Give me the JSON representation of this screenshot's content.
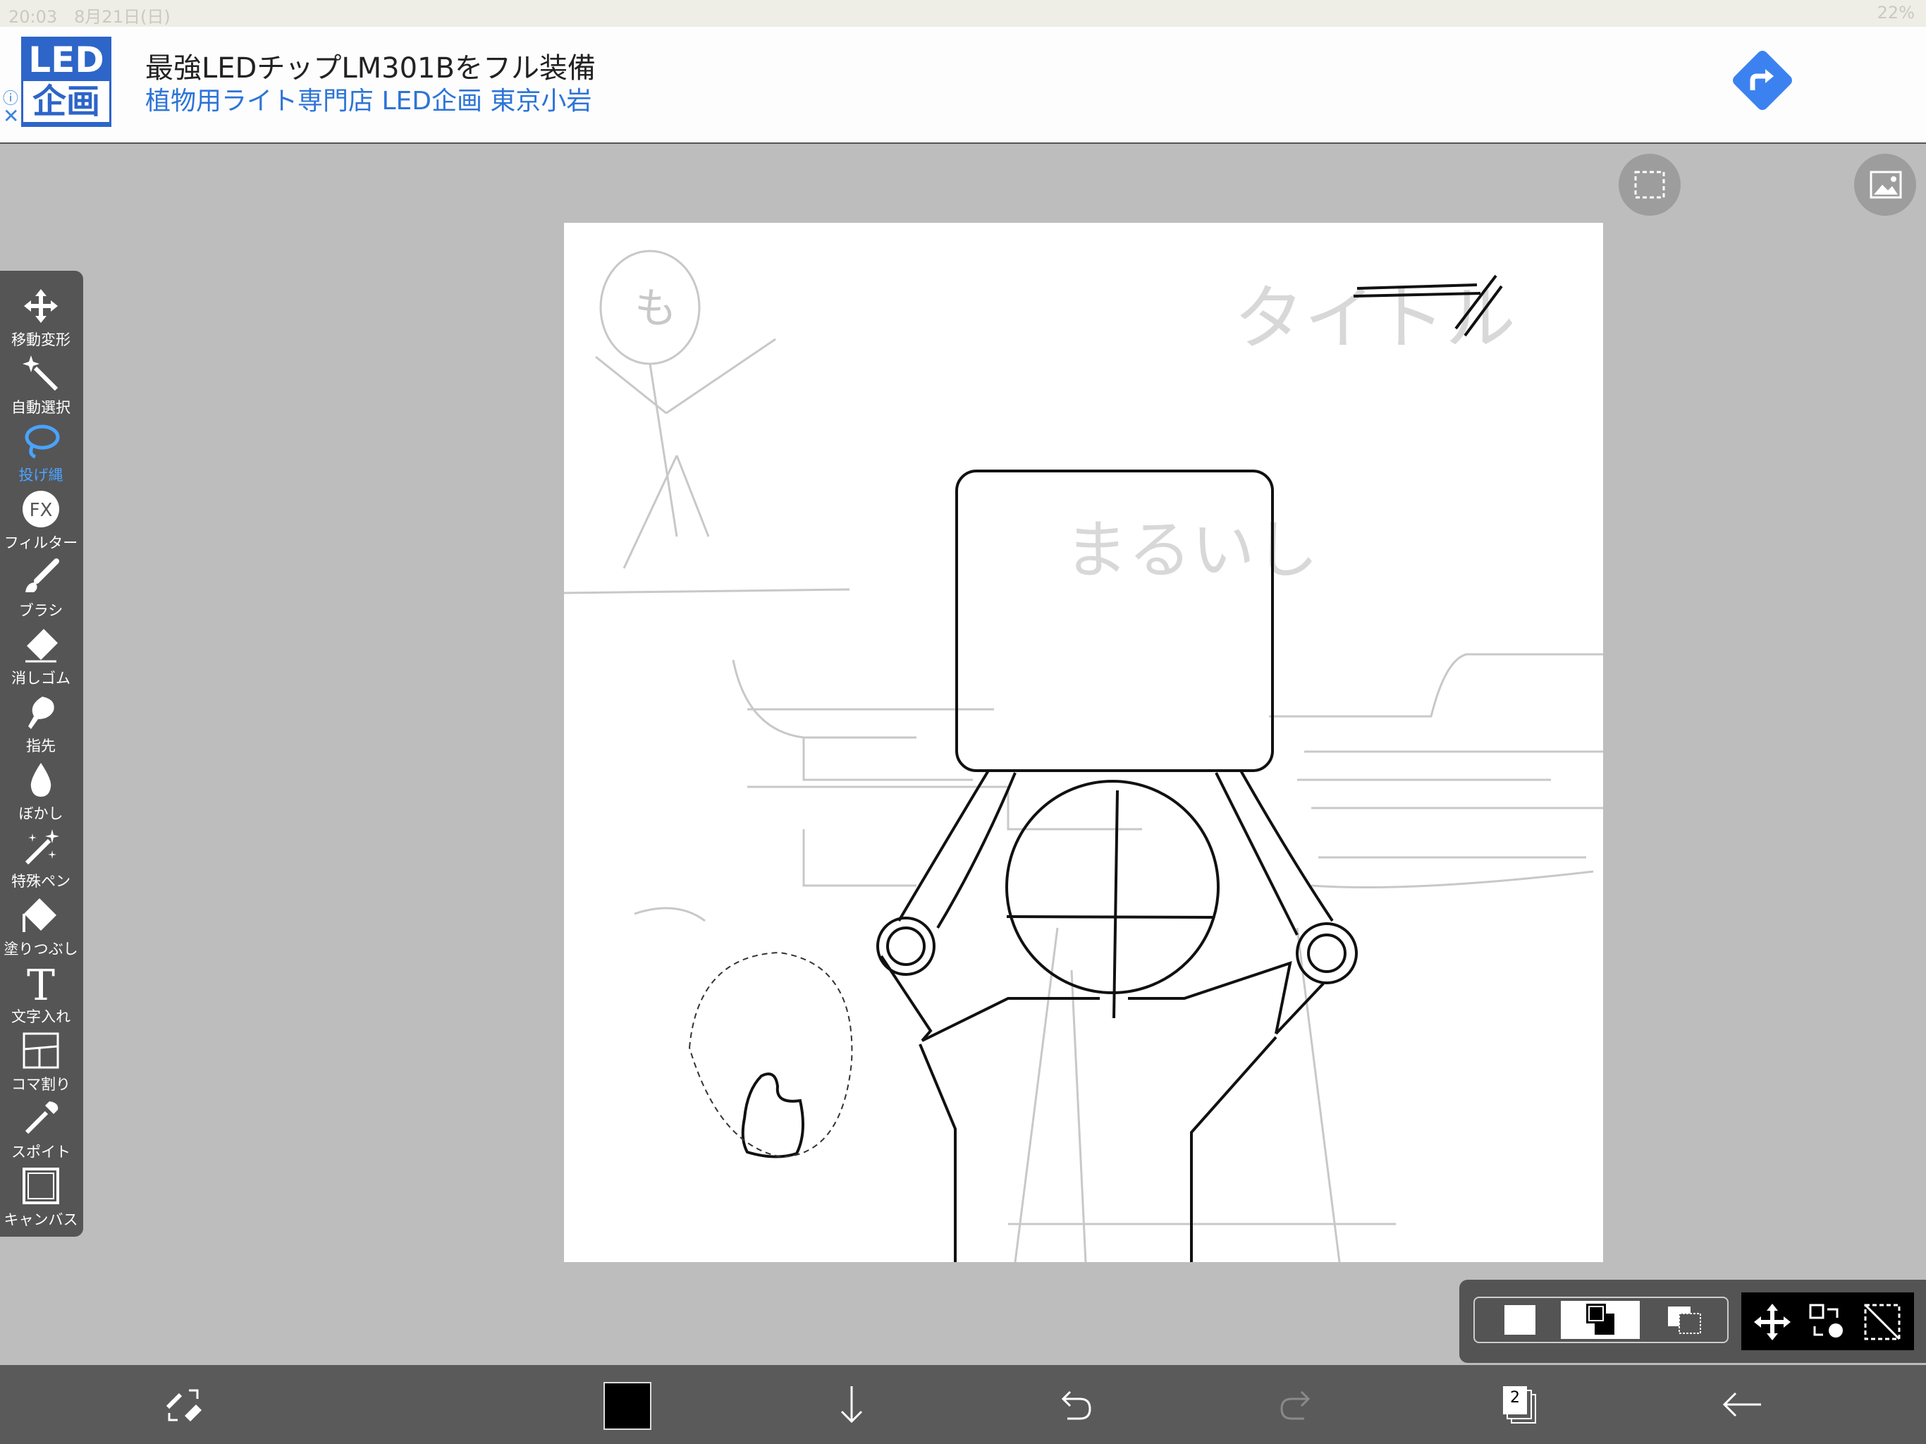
{
  "status_bar": {
    "time_date": "20:03　8月21日(日)",
    "battery": "22%"
  },
  "ad": {
    "logo_line1": "LED",
    "logo_line2": "企画",
    "title": "最強LEDチップLM301Bをフル装備",
    "subtitle": "植物用ライト専門店 LED企画 東京小岩",
    "info_icon": "info-icon",
    "close_label": "✕"
  },
  "top_buttons": [
    {
      "icon": "selection-icon"
    },
    {
      "icon": "image-icon"
    }
  ],
  "toolbar": {
    "active_tool": "投げ縄",
    "active_color": "#4aa3ff",
    "tools": [
      {
        "label": "移動変形",
        "icon": "move-transform-icon"
      },
      {
        "label": "自動選択",
        "icon": "magic-wand-icon"
      },
      {
        "label": "投げ縄",
        "icon": "lasso-icon"
      },
      {
        "label": "フィルター",
        "icon": "fx-filter-icon"
      },
      {
        "label": "ブラシ",
        "icon": "brush-icon"
      },
      {
        "label": "消しゴム",
        "icon": "eraser-icon"
      },
      {
        "label": "指先",
        "icon": "finger-smudge-icon"
      },
      {
        "label": "ぼかし",
        "icon": "blur-drop-icon"
      },
      {
        "label": "特殊ペン",
        "icon": "special-pen-icon"
      },
      {
        "label": "塗りつぶし",
        "icon": "bucket-fill-icon"
      },
      {
        "label": "文字入れ",
        "icon": "text-icon"
      },
      {
        "label": "コマ割り",
        "icon": "panel-layout-icon"
      },
      {
        "label": "スポイト",
        "icon": "eyedropper-icon"
      },
      {
        "label": "キャンバス",
        "icon": "canvas-icon"
      }
    ]
  },
  "canvas": {
    "background": "#ffffff",
    "sketch_text_1": "タイトル",
    "sketch_text_2": "まるいし",
    "sketch_text_3": "も"
  },
  "selection_bar": {
    "modes": [
      "new-selection-icon",
      "add-selection-icon",
      "subtract-selection-icon"
    ],
    "actions": [
      "move-selection-icon",
      "transform-selection-icon",
      "deselect-icon"
    ]
  },
  "bottom_bar": {
    "primary_color": "#000000",
    "layer_count": "2",
    "items": [
      "tool-swap-icon",
      "color-swatch",
      "download-icon",
      "undo-icon",
      "redo-icon",
      "layers-icon",
      "back-arrow-icon"
    ]
  }
}
